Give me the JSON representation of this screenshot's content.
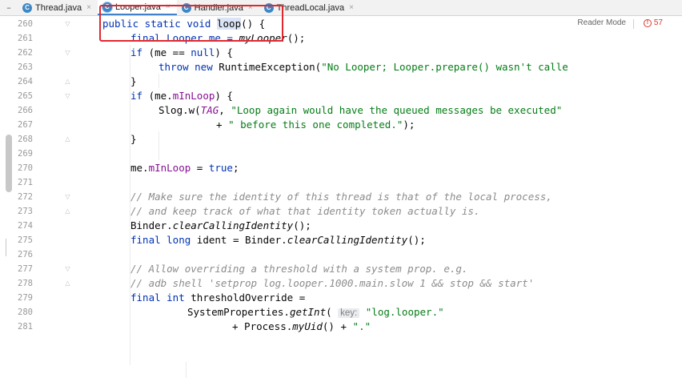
{
  "tabs": [
    {
      "label": "Thread.java",
      "icon": "class-icon",
      "active": false
    },
    {
      "label": "Looper.java",
      "icon": "class-icon",
      "active": true
    },
    {
      "label": "Handler.java",
      "icon": "class-icon",
      "active": false
    },
    {
      "label": "ThreadLocal.java",
      "icon": "class-icon",
      "active": false
    }
  ],
  "tab_close_glyph": "×",
  "tab_menu_glyph": "–",
  "class_icon_letter": "C",
  "editor": {
    "reader_mode_label": "Reader Mode",
    "problem_count": "57"
  },
  "lines": [
    {
      "n": "260",
      "fold": "▽"
    },
    {
      "n": "261",
      "fold": ""
    },
    {
      "n": "262",
      "fold": "▽"
    },
    {
      "n": "263",
      "fold": ""
    },
    {
      "n": "264",
      "fold": "△"
    },
    {
      "n": "265",
      "fold": "▽"
    },
    {
      "n": "266",
      "fold": ""
    },
    {
      "n": "267",
      "fold": ""
    },
    {
      "n": "268",
      "fold": "△"
    },
    {
      "n": "269",
      "fold": ""
    },
    {
      "n": "270",
      "fold": ""
    },
    {
      "n": "271",
      "fold": ""
    },
    {
      "n": "272",
      "fold": "▽"
    },
    {
      "n": "273",
      "fold": "△"
    },
    {
      "n": "274",
      "fold": ""
    },
    {
      "n": "275",
      "fold": ""
    },
    {
      "n": "276",
      "fold": ""
    },
    {
      "n": "277",
      "fold": "▽"
    },
    {
      "n": "278",
      "fold": "△"
    },
    {
      "n": "279",
      "fold": ""
    },
    {
      "n": "280",
      "fold": ""
    },
    {
      "n": "281",
      "fold": ""
    }
  ],
  "code": {
    "l260_a": "public static void ",
    "l260_b": "loop",
    "l260_c": "() {",
    "l261_a": "final Looper me = ",
    "l261_b": "myLooper",
    "l261_c": "();",
    "l262_a": "if ",
    "l262_b": "(me == ",
    "l262_c": "null",
    "l262_d": ") {",
    "l263_a": "throw new ",
    "l263_b": "RuntimeException(",
    "l263_c": "\"No Looper; Looper.prepare() wasn't calle",
    "l264": "}",
    "l265_a": "if ",
    "l265_b": "(me.",
    "l265_c": "mInLoop",
    "l265_d": ") {",
    "l266_a": "Slog.",
    "l266_b": "w",
    "l266_c": "(",
    "l266_d": "TAG",
    "l266_e": ", ",
    "l266_f": "\"Loop again would have the queued messages be executed\"",
    "l267_a": "+ ",
    "l267_b": "\" before this one completed.\"",
    "l267_c": ");",
    "l268": "}",
    "l270_a": "me.",
    "l270_b": "mInLoop",
    "l270_c": " = ",
    "l270_d": "true",
    "l270_e": ";",
    "l272": "// Make sure the identity of this thread is that of the local process,",
    "l273": "// and keep track of what that identity token actually is.",
    "l274_a": "Binder.",
    "l274_b": "clearCallingIdentity",
    "l274_c": "();",
    "l275_a": "final long ",
    "l275_b": "ident = Binder.",
    "l275_c": "clearCallingIdentity",
    "l275_d": "();",
    "l277": "// Allow overriding a threshold with a system prop. e.g.",
    "l278": "// adb shell 'setprop log.looper.1000.main.slow 1 && stop && start'",
    "l279_a": "final int ",
    "l279_b": "thresholdOverride =",
    "l280_a": "SystemProperties.",
    "l280_b": "getInt",
    "l280_c": "( ",
    "l280_param": "key:",
    "l280_d": " ",
    "l280_e": "\"log.looper.\"",
    "l281_a": "+ Process.",
    "l281_b": "myUid",
    "l281_c": "() + ",
    "l281_d": "\".\""
  },
  "colors": {
    "keyword": "#0033b3",
    "field": "#871094",
    "string": "#067d17",
    "comment": "#8c8c8c",
    "annotation_box": "#e2282f",
    "active_tab_underline": "#4083c9"
  }
}
